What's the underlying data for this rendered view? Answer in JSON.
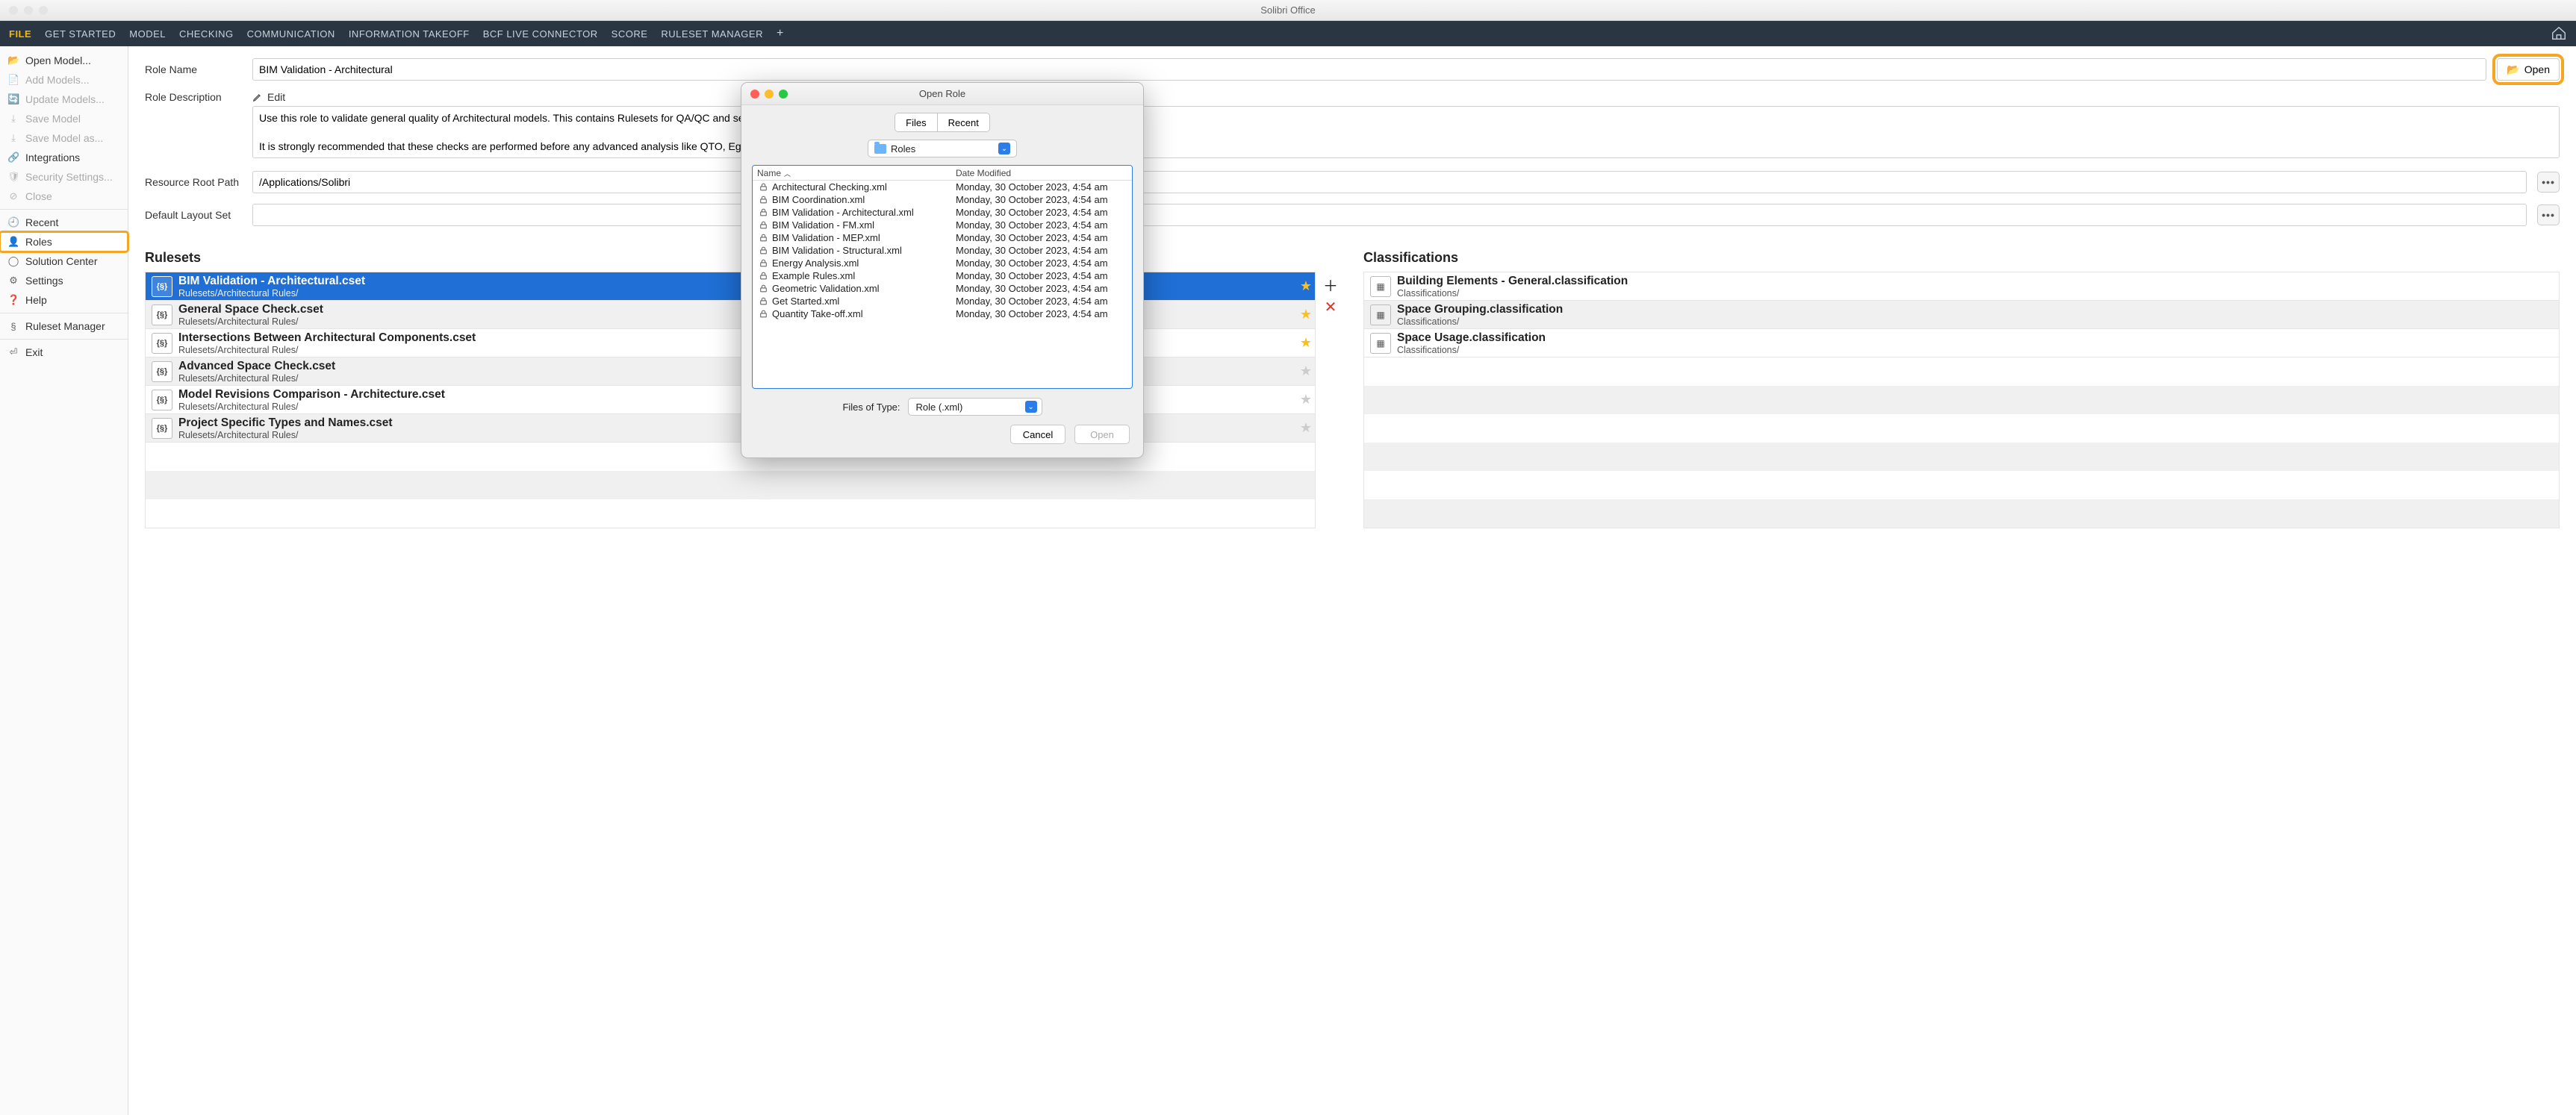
{
  "window": {
    "title": "Solibri Office"
  },
  "menubar": {
    "items": [
      "FILE",
      "GET STARTED",
      "MODEL",
      "CHECKING",
      "COMMUNICATION",
      "INFORMATION TAKEOFF",
      "BCF LIVE CONNECTOR",
      "SCORE",
      "RULESET MANAGER"
    ],
    "active_index": 0
  },
  "sidebar": {
    "groups": [
      [
        {
          "icon": "folder-open",
          "label": "Open Model...",
          "disabled": false
        },
        {
          "icon": "plus-doc",
          "label": "Add Models...",
          "disabled": true
        },
        {
          "icon": "refresh",
          "label": "Update Models...",
          "disabled": true
        },
        {
          "icon": "save",
          "label": "Save Model",
          "disabled": true
        },
        {
          "icon": "save",
          "label": "Save Model as...",
          "disabled": true
        },
        {
          "icon": "link",
          "label": "Integrations",
          "disabled": false
        },
        {
          "icon": "shield",
          "label": "Security Settings...",
          "disabled": true
        },
        {
          "icon": "x",
          "label": "Close",
          "disabled": true
        }
      ],
      [
        {
          "icon": "clock",
          "label": "Recent",
          "disabled": false
        },
        {
          "icon": "roles",
          "label": "Roles",
          "disabled": false,
          "selected": true,
          "highlight": true
        },
        {
          "icon": "circle",
          "label": "Solution Center",
          "disabled": false
        },
        {
          "icon": "gear",
          "label": "Settings",
          "disabled": false
        },
        {
          "icon": "help",
          "label": "Help",
          "disabled": false
        }
      ],
      [
        {
          "icon": "rules",
          "label": "Ruleset Manager",
          "disabled": false
        }
      ],
      [
        {
          "icon": "exit",
          "label": "Exit",
          "disabled": false
        }
      ]
    ]
  },
  "form": {
    "role_name_label": "Role Name",
    "role_name_value": "BIM Validation - Architectural",
    "open_label": "Open",
    "desc_label": "Role Description",
    "edit_label": "Edit",
    "desc_value": "Use this role to validate general quality of Architectural models. This contains Rulesets for QA/QC and selected Information Takeoffs.\n\nIt is strongly recommended that these checks are performed before any advanced analysis like QTO, Egress",
    "root_label": "Resource Root Path",
    "root_value": "/Applications/Solibri",
    "layout_label": "Default Layout Set",
    "layout_value": ""
  },
  "rulesets": {
    "title": "Rulesets",
    "items": [
      {
        "name": "BIM Validation - Architectural.cset",
        "path": "Rulesets/Architectural Rules/",
        "star": true,
        "selected": true
      },
      {
        "name": "General Space Check.cset",
        "path": "Rulesets/Architectural Rules/",
        "star": true
      },
      {
        "name": "Intersections Between Architectural Components.cset",
        "path": "Rulesets/Architectural Rules/",
        "star": true
      },
      {
        "name": "Advanced Space Check.cset",
        "path": "Rulesets/Architectural Rules/",
        "star": false
      },
      {
        "name": "Model Revisions Comparison - Architecture.cset",
        "path": "Rulesets/Architectural Rules/",
        "star": false
      },
      {
        "name": "Project Specific Types and Names.cset",
        "path": "Rulesets/Architectural Rules/",
        "star": false
      }
    ]
  },
  "classifications": {
    "title": "Classifications",
    "items": [
      {
        "name": "Building Elements - General.classification",
        "path": "Classifications/"
      },
      {
        "name": "Space Grouping.classification",
        "path": "Classifications/"
      },
      {
        "name": "Space Usage.classification",
        "path": "Classifications/"
      }
    ]
  },
  "dialog": {
    "title": "Open Role",
    "tabs": {
      "files": "Files",
      "recent": "Recent",
      "active": "files"
    },
    "folder": "Roles",
    "columns": {
      "name": "Name",
      "date": "Date Modified"
    },
    "files": [
      {
        "name": "Architectural Checking.xml",
        "date": "Monday, 30 October 2023, 4:54 am"
      },
      {
        "name": "BIM Coordination.xml",
        "date": "Monday, 30 October 2023, 4:54 am"
      },
      {
        "name": "BIM Validation - Architectural.xml",
        "date": "Monday, 30 October 2023, 4:54 am"
      },
      {
        "name": "BIM Validation - FM.xml",
        "date": "Monday, 30 October 2023, 4:54 am"
      },
      {
        "name": "BIM Validation - MEP.xml",
        "date": "Monday, 30 October 2023, 4:54 am"
      },
      {
        "name": "BIM Validation - Structural.xml",
        "date": "Monday, 30 October 2023, 4:54 am"
      },
      {
        "name": "Energy Analysis.xml",
        "date": "Monday, 30 October 2023, 4:54 am"
      },
      {
        "name": "Example Rules.xml",
        "date": "Monday, 30 October 2023, 4:54 am"
      },
      {
        "name": "Geometric Validation.xml",
        "date": "Monday, 30 October 2023, 4:54 am"
      },
      {
        "name": "Get Started.xml",
        "date": "Monday, 30 October 2023, 4:54 am"
      },
      {
        "name": "Quantity Take-off.xml",
        "date": "Monday, 30 October 2023, 4:54 am"
      }
    ],
    "filetype_label": "Files of Type:",
    "filetype_value": "Role (.xml)",
    "cancel": "Cancel",
    "open": "Open"
  }
}
